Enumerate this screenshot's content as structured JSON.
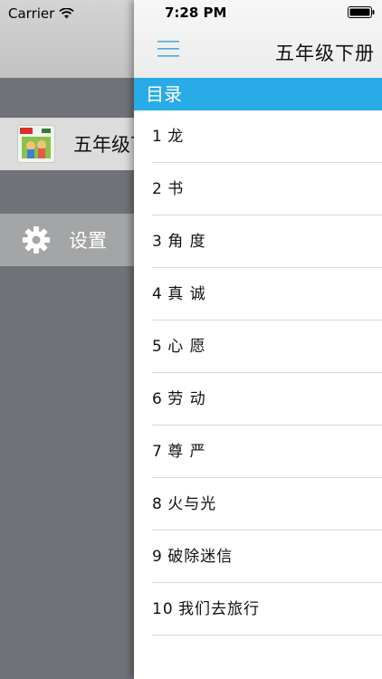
{
  "status_bar": {
    "carrier": "Carrier",
    "time": "7:28 PM"
  },
  "drawer": {
    "items": [
      {
        "label": "五年级下册",
        "icon": "book-cover-thumbnail"
      },
      {
        "label": "设置",
        "icon": "gear-icon"
      }
    ]
  },
  "nav": {
    "title": "五年级下册",
    "menu_icon": "hamburger-icon"
  },
  "section": {
    "title": "目录"
  },
  "toc": [
    {
      "num": "1",
      "title": "龙"
    },
    {
      "num": "2",
      "title": "书"
    },
    {
      "num": "3",
      "title": "角 度"
    },
    {
      "num": "4",
      "title": "真 诚"
    },
    {
      "num": "5",
      "title": "心 愿"
    },
    {
      "num": "6",
      "title": "劳 动"
    },
    {
      "num": "7",
      "title": "尊 严"
    },
    {
      "num": "8",
      "title": "火与光"
    },
    {
      "num": "9",
      "title": "破除迷信"
    },
    {
      "num": "10",
      "title": "我们去旅行"
    }
  ],
  "colors": {
    "accent": "#29abe8",
    "drawer_bg": "#6f7377"
  }
}
